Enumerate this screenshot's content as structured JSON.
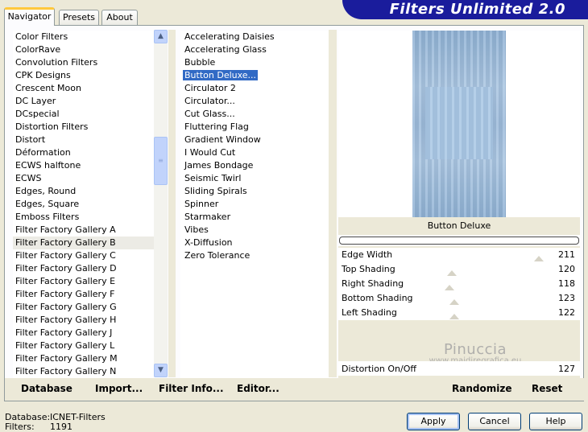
{
  "tabs": [
    {
      "label": "Navigator",
      "active": true
    },
    {
      "label": "Presets",
      "active": false
    },
    {
      "label": "About",
      "active": false
    }
  ],
  "banner": {
    "title": "Filters Unlimited 2.0"
  },
  "categories": {
    "selected": "Filter Factory Gallery B",
    "items": [
      "Color Filters",
      "ColorRave",
      "Convolution Filters",
      "CPK Designs",
      "Crescent Moon",
      "DC Layer",
      "DCspecial",
      "Distortion Filters",
      "Distort",
      "Déformation",
      "ECWS halftone",
      "ECWS",
      "Edges, Round",
      "Edges, Square",
      "Emboss Filters",
      "Filter Factory Gallery A",
      "Filter Factory Gallery B",
      "Filter Factory Gallery C",
      "Filter Factory Gallery D",
      "Filter Factory Gallery E",
      "Filter Factory Gallery F",
      "Filter Factory Gallery G",
      "Filter Factory Gallery H",
      "Filter Factory Gallery J",
      "Filter Factory Gallery L",
      "Filter Factory Gallery M",
      "Filter Factory Gallery N"
    ]
  },
  "filters": {
    "selected": "Button Deluxe...",
    "items": [
      "Accelerating Daisies",
      "Accelerating Glass",
      "Bubble",
      "Button Deluxe...",
      "Circulator 2",
      "Circulator...",
      "Cut Glass...",
      "Fluttering Flag",
      "Gradient Window",
      "I Would Cut",
      "James Bondage",
      "Seismic Twirl",
      "Sliding Spirals",
      "Spinner",
      "Starmaker",
      "Vibes",
      "X-Diffusion",
      "Zero Tolerance"
    ]
  },
  "preview": {
    "filter_name": "Button Deluxe",
    "progress": 0
  },
  "sliders": [
    {
      "label": "Edge Width",
      "value": "211",
      "level": 0.83
    },
    {
      "label": "Top Shading",
      "value": "120",
      "level": 0.47
    },
    {
      "label": "Right Shading",
      "value": "118",
      "level": 0.46
    },
    {
      "label": "Bottom Shading",
      "value": "123",
      "level": 0.48
    },
    {
      "label": "Left Shading",
      "value": "122",
      "level": 0.48
    }
  ],
  "distortion": {
    "label": "Distortion On/Off",
    "value": "127"
  },
  "watermark": {
    "line1": "Pinuccia",
    "line2": "www.maidiregrafica.eu"
  },
  "actions": {
    "database": "Database",
    "import": "Import...",
    "filter_info": "Filter Info...",
    "editor": "Editor...",
    "randomize": "Randomize",
    "reset": "Reset"
  },
  "footer": {
    "database_label": "Database:",
    "database_value": "ICNET-Filters",
    "filters_label": "Filters:",
    "filters_value": "1191"
  },
  "buttons": {
    "apply": "Apply",
    "cancel": "Cancel",
    "help": "Help"
  }
}
